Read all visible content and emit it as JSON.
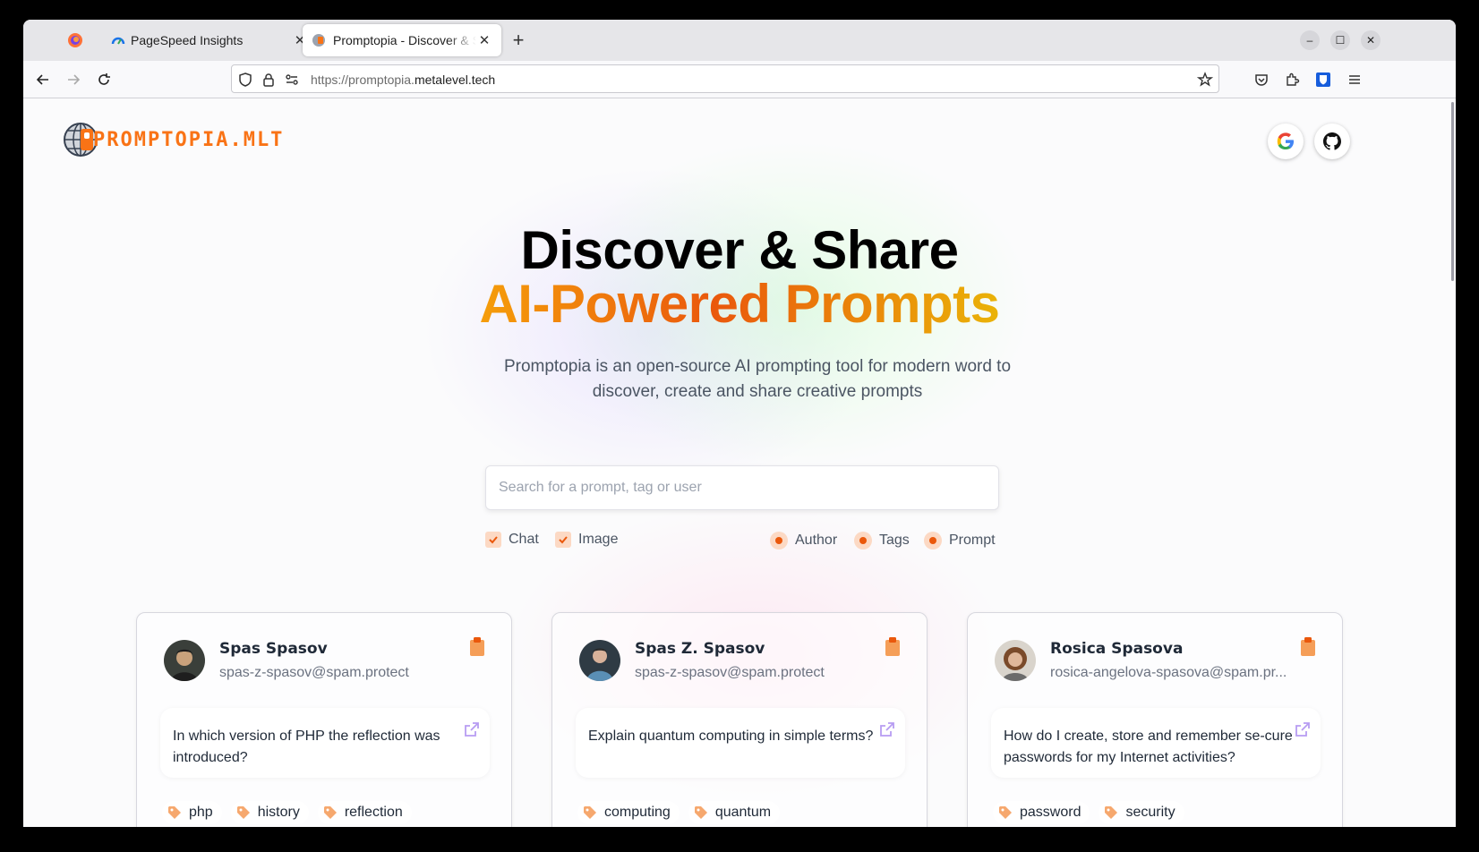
{
  "browser": {
    "tabs": [
      {
        "title": "PageSpeed Insights"
      },
      {
        "title": "Promptopia - Discover & Share AI Prompts"
      }
    ],
    "url": {
      "prefix": "https://promptopia.",
      "host": "metalevel.tech"
    }
  },
  "site": {
    "logo_text": "PROMPTOPIA.MLT",
    "hero_line1": "Discover & Share",
    "hero_line2": "AI-Powered Prompts",
    "description": "Promptopia is an open-source AI prompting tool for modern word to discover, create and share creative prompts",
    "search_placeholder": "Search for a prompt, tag or user",
    "filters": {
      "checkboxes": [
        "Chat",
        "Image"
      ],
      "radios": [
        "Author",
        "Tags",
        "Prompt"
      ]
    },
    "cards": [
      {
        "name": "Spas Spasov",
        "email": "spas-z-spasov@spam.protect",
        "prompt": "In which version of PHP the reflection was introduced?",
        "tags": [
          "php",
          "history",
          "reflection"
        ]
      },
      {
        "name": "Spas Z. Spasov",
        "email": "spas-z-spasov@spam.protect",
        "prompt": "Explain quantum computing in simple terms?",
        "tags": [
          "computing",
          "quantum"
        ]
      },
      {
        "name": "Rosica Spasova",
        "email": "rosica-angelova-spasova@spam.pr...",
        "prompt": "How do I create, store and remember se-cure passwords for my Internet activities?",
        "tags": [
          "password",
          "security"
        ]
      }
    ]
  },
  "colors": {
    "accent": "#ea580c",
    "accent_light": "#fcd9c4",
    "heading": "#000000"
  }
}
